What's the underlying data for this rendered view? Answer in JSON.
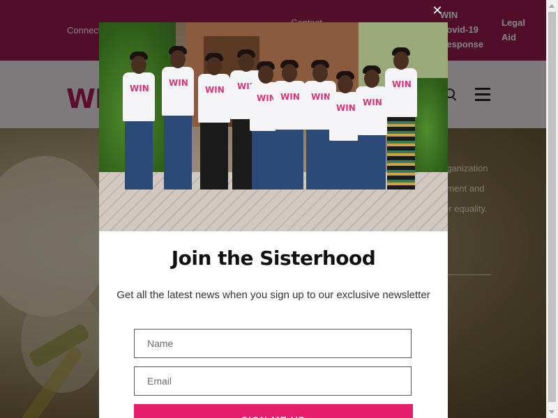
{
  "topbar": {
    "connect_label": "Connect",
    "contact_label": "Contact",
    "win_covid_label": "WIN\nCovid-19\nResponse",
    "legal_aid_label": "Legal\nAid"
  },
  "header": {
    "logo_text": "WIN"
  },
  "hero": {
    "line1": "rganization",
    "line2": "rment and",
    "line3": "er equality."
  },
  "photo": {
    "shirt_logo": "WIN"
  },
  "modal": {
    "close_symbol": "✕",
    "title": "Join the Sisterhood",
    "subtitle": "Get all the latest news when you sign up to our exclusive newsletter",
    "name_placeholder": "Name",
    "email_placeholder": "Email",
    "submit_label": "SIGN ME UP"
  },
  "colors": {
    "brand_magenta": "#9c1c52",
    "button_pink": "#e51d6d",
    "logo_pink": "#b0195a"
  },
  "icons": [
    "search-icon",
    "menu-icon",
    "close-icon"
  ]
}
